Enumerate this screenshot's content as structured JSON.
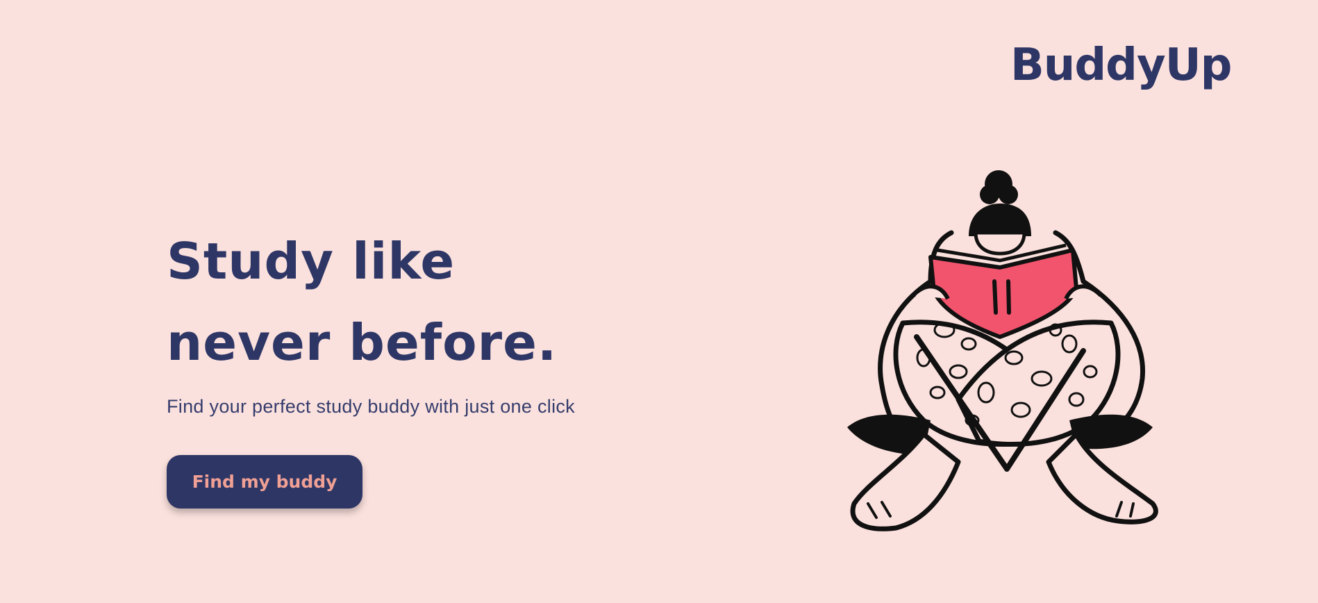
{
  "brand": {
    "name": "BuddyUp"
  },
  "hero": {
    "headline_line1": "Study like",
    "headline_line2": "never before.",
    "subtitle": "Find your perfect study buddy with just one click",
    "cta_label": "Find my buddy"
  },
  "colors": {
    "background": "#fbe1dd",
    "primary": "#2e3666",
    "button_text": "#f0a094",
    "book": "#f2546d"
  },
  "illustration": {
    "icon": "person-reading-book-illustration"
  }
}
